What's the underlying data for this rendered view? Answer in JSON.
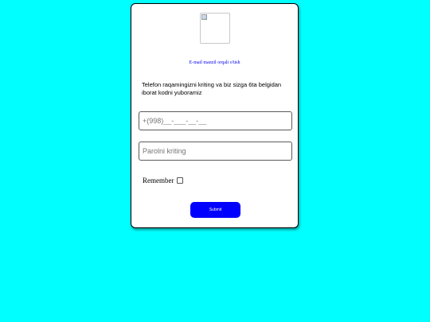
{
  "logo": {
    "icon": "broken-image-icon"
  },
  "email_link": {
    "label": "E-mail manzil orqali o'tish"
  },
  "info": {
    "text": "Telefon raqamingizni kriting va biz sizga 6ta belgidan iborat kodni yuboramiz"
  },
  "phone_field": {
    "placeholder": "+(998)__-___-__-__",
    "value": ""
  },
  "password_field": {
    "placeholder": "Parolni kriting",
    "value": ""
  },
  "remember": {
    "label": "Remember",
    "checked": false
  },
  "submit": {
    "label": "Submit"
  },
  "colors": {
    "background": "#00FFFF",
    "card": "#FFFFFF",
    "link": "#0000EE",
    "button": "#0000FF",
    "button_text": "#FFFFFF"
  }
}
